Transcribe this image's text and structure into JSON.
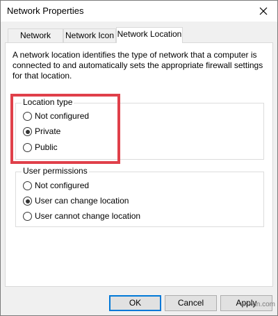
{
  "window": {
    "title": "Network Properties"
  },
  "tabs": [
    {
      "label": "Network Name"
    },
    {
      "label": "Network Icon"
    },
    {
      "label": "Network Location",
      "active": true
    }
  ],
  "description": "A network location identifies the type of network that a computer is connected to and automatically sets the appropriate firewall settings for that location.",
  "location_type": {
    "label": "Location type",
    "options": [
      {
        "label": "Not configured",
        "checked": false
      },
      {
        "label": "Private",
        "checked": true
      },
      {
        "label": "Public",
        "checked": false
      }
    ]
  },
  "user_permissions": {
    "label": "User permissions",
    "options": [
      {
        "label": "Not configured",
        "checked": false
      },
      {
        "label": "User can change location",
        "checked": true
      },
      {
        "label": "User cannot change location",
        "checked": false
      }
    ]
  },
  "buttons": {
    "ok": "OK",
    "cancel": "Cancel",
    "apply": "Apply"
  },
  "highlight_color": "#e0404a",
  "accent_color": "#0078d7",
  "watermark": "wsxdn.com"
}
